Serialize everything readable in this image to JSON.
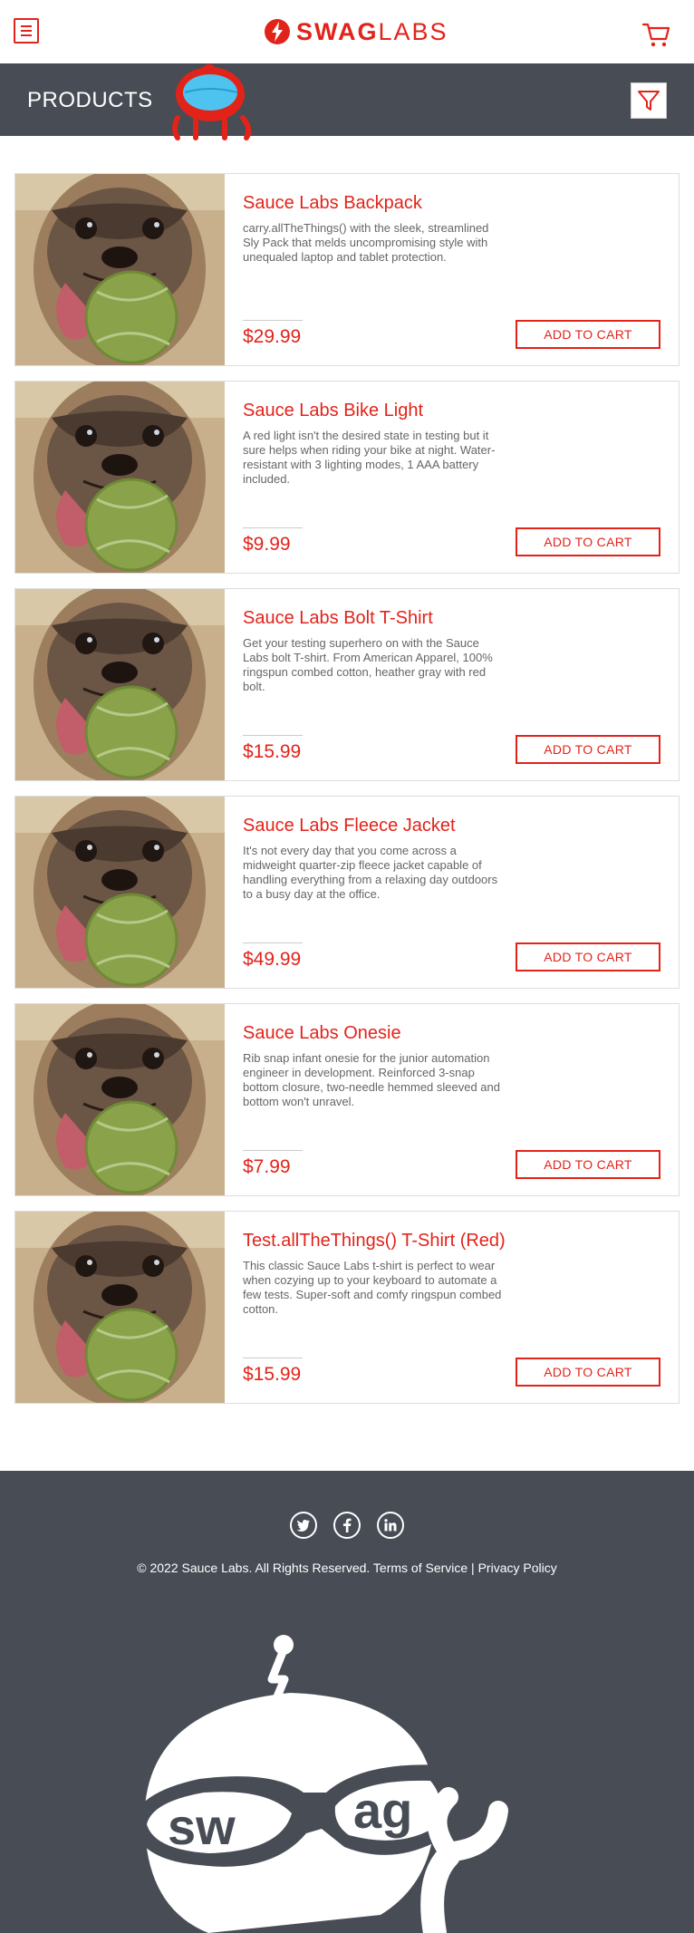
{
  "header": {
    "logo_bold": "SWAG",
    "logo_thin": "LABS",
    "menu_icon": "hamburger-menu-icon",
    "cart_icon": "shopping-cart-icon"
  },
  "subheader": {
    "title": "PRODUCTS",
    "filter_icon": "filter-funnel-icon"
  },
  "colors": {
    "brand_red": "#e2231a",
    "header_dark": "#474c55"
  },
  "products": [
    {
      "name": "Sauce Labs Backpack",
      "desc": "carry.allTheThings() with the sleek, streamlined Sly Pack that melds uncompromising style with unequaled laptop and tablet protection.",
      "price": "$29.99",
      "button": "ADD TO CART"
    },
    {
      "name": "Sauce Labs Bike Light",
      "desc": "A red light isn't the desired state in testing but it sure helps when riding your bike at night. Water-resistant with 3 lighting modes, 1 AAA battery included.",
      "price": "$9.99",
      "button": "ADD TO CART"
    },
    {
      "name": "Sauce Labs Bolt T-Shirt",
      "desc": "Get your testing superhero on with the Sauce Labs bolt T-shirt. From American Apparel, 100% ringspun combed cotton, heather gray with red bolt.",
      "price": "$15.99",
      "button": "ADD TO CART"
    },
    {
      "name": "Sauce Labs Fleece Jacket",
      "desc": "It's not every day that you come across a midweight quarter-zip fleece jacket capable of handling everything from a relaxing day outdoors to a busy day at the office.",
      "price": "$49.99",
      "button": "ADD TO CART"
    },
    {
      "name": "Sauce Labs Onesie",
      "desc": "Rib snap infant onesie for the junior automation engineer in development. Reinforced 3-snap bottom closure, two-needle hemmed sleeved and bottom won't unravel.",
      "price": "$7.99",
      "button": "ADD TO CART"
    },
    {
      "name": "Test.allTheThings() T-Shirt (Red)",
      "desc": "This classic Sauce Labs t-shirt is perfect to wear when cozying up to your keyboard to automate a few tests. Super-soft and comfy ringspun combed cotton.",
      "price": "$15.99",
      "button": "ADD TO CART"
    }
  ],
  "footer": {
    "social": [
      "twitter-icon",
      "facebook-icon",
      "linkedin-icon"
    ],
    "copyright": "© 2022 Sauce Labs. All Rights Reserved. Terms of Service | Privacy Policy",
    "robot_text_left": "sw",
    "robot_text_right": "ag"
  }
}
